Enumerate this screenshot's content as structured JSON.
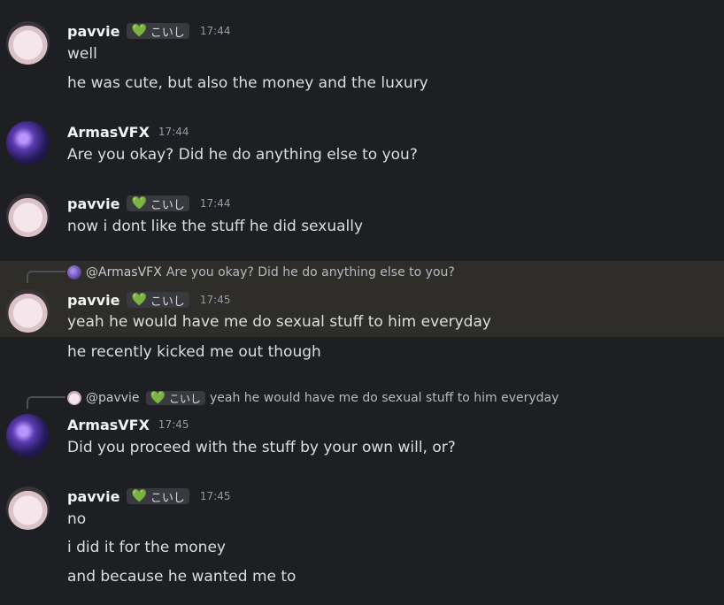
{
  "messages": [
    {
      "author": "pavvie",
      "tag": "こいし",
      "time": "17:44",
      "lines": [
        "well",
        "he was cute, but also the money and the luxury"
      ]
    },
    {
      "author": "ArmasVFX",
      "time": "17:44",
      "lines": [
        "Are you okay? Did he do anything else to you?"
      ]
    },
    {
      "author": "pavvie",
      "tag": "こいし",
      "time": "17:44",
      "lines": [
        "now i dont like the stuff he did sexually"
      ]
    },
    {
      "author": "pavvie",
      "tag": "こいし",
      "time": "17:45",
      "reply": {
        "mention": "@ArmasVFX",
        "text": "Are you okay? Did he do anything else to you?"
      },
      "lines": [
        "yeah he would have me do sexual stuff to him everyday",
        "he recently kicked me out though"
      ]
    },
    {
      "author": "ArmasVFX",
      "time": "17:45",
      "reply": {
        "mention": "@pavvie",
        "tag": "こいし",
        "text": "yeah he would have me do sexual stuff to him everyday"
      },
      "lines": [
        "Did you proceed with the stuff by your own will, or?"
      ]
    },
    {
      "author": "pavvie",
      "tag": "こいし",
      "time": "17:45",
      "lines": [
        "no",
        "i did it for the money",
        "and because he wanted me to"
      ]
    }
  ],
  "colors": {
    "background": "#1e1f22",
    "highlight": "#2e2d2a",
    "tag_heart": "#3ba55d"
  },
  "icons": {
    "tag_icon": "green-heart-icon"
  }
}
